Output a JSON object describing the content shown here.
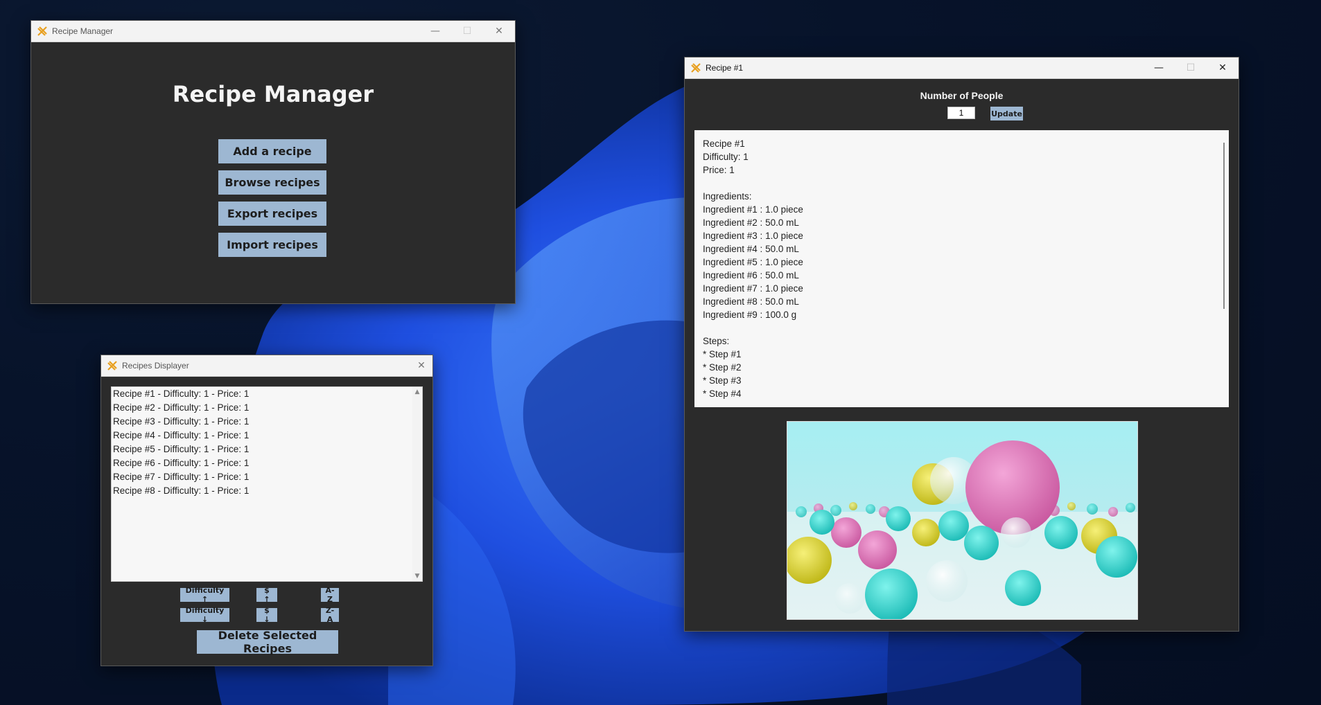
{
  "manager": {
    "window_title": "Recipe Manager",
    "heading": "Recipe Manager",
    "buttons": [
      "Add a recipe",
      "Browse recipes",
      "Export recipes",
      "Import recipes"
    ]
  },
  "displayer": {
    "window_title": "Recipes Displayer",
    "items": [
      "Recipe #1 - Difficulty: 1 - Price: 1",
      "Recipe #2 - Difficulty: 1 - Price: 1",
      "Recipe #3 - Difficulty: 1 - Price: 1",
      "Recipe #4 - Difficulty: 1 - Price: 1",
      "Recipe #5 - Difficulty: 1 - Price: 1",
      "Recipe #6 - Difficulty: 1 - Price: 1",
      "Recipe #7 - Difficulty: 1 - Price: 1",
      "Recipe #8 - Difficulty: 1 - Price: 1"
    ],
    "sort": {
      "difficulty_up": "Difficulty ↑",
      "difficulty_down": "Difficulty ↓",
      "price_up": "$ ↑",
      "price_down": "$ ↓",
      "az": "A-Z",
      "za": "Z-A"
    },
    "delete_label": "Delete Selected Recipes"
  },
  "recipe": {
    "window_title": "Recipe #1",
    "people_label": "Number of People",
    "people_value": "1",
    "update_label": "Update",
    "lines": [
      "Recipe #1",
      "Difficulty: 1",
      "Price: 1",
      "",
      "Ingredients:",
      "Ingredient #1 : 1.0 piece",
      "Ingredient #2 : 50.0 mL",
      "Ingredient #3 : 1.0 piece",
      "Ingredient #4 : 50.0 mL",
      "Ingredient #5 : 1.0 piece",
      "Ingredient #6 : 50.0 mL",
      "Ingredient #7 : 1.0 piece",
      "Ingredient #8 : 50.0 mL",
      "Ingredient #9 : 100.0 g",
      "",
      "Steps:",
      "* Step #1",
      "* Step #2",
      "* Step #3",
      "* Step #4"
    ]
  },
  "window_controls": {
    "minimize": "—",
    "maximize": "☐",
    "close": "✕"
  },
  "colors": {
    "window_bg": "#2b2b2b",
    "button_bg": "#9db7d2",
    "text_bg": "#f7f7f7",
    "titlebar_bg": "#f3f3f3"
  },
  "icons": [
    "app-feather-icon",
    "minimize-icon",
    "maximize-icon",
    "close-icon",
    "scroll-up-icon",
    "scroll-down-icon"
  ]
}
